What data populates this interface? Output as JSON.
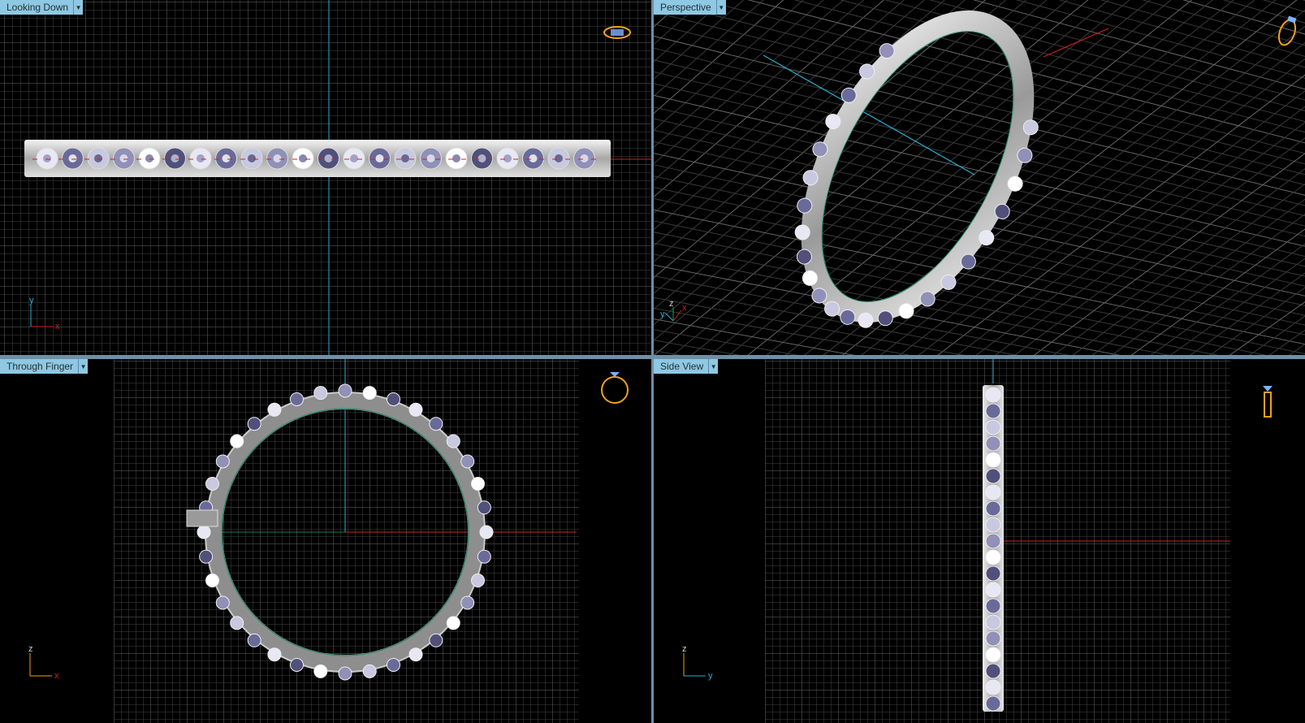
{
  "viewports": {
    "top": {
      "label": "Looking Down"
    },
    "perspective": {
      "label": "Perspective"
    },
    "front": {
      "label": "Through Finger"
    },
    "side": {
      "label": "Side View"
    }
  },
  "axes": {
    "top": {
      "up": "y",
      "right": "x"
    },
    "perspective": {
      "a": "y",
      "b": "z",
      "c": "x"
    },
    "front": {
      "up": "z",
      "right": "x"
    },
    "side": {
      "up": "z",
      "right": "y"
    }
  },
  "icons": {
    "top": "ring-top-view-icon",
    "perspective": "ring-perspective-icon",
    "front": "ring-front-view-icon",
    "side": "ring-side-view-icon"
  },
  "colors": {
    "label_bg": "#8ec8e3",
    "grid": "#5a5a5a",
    "x_axis": "#d02020",
    "y_axis": "#2ab0d0",
    "z_axis": "#20a060",
    "icon": "#f0a020"
  }
}
